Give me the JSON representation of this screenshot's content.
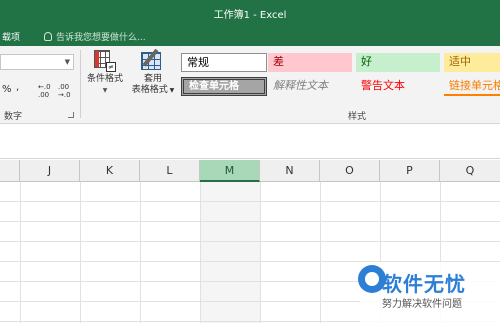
{
  "window": {
    "title": "工作簿1 - Excel"
  },
  "tabs": {
    "page_layout": "载项"
  },
  "tell_me": {
    "placeholder": "告诉我您想要做什么..."
  },
  "number_group": {
    "percent": "%",
    "comma": ",",
    "increase_decimal": "←.0 .00",
    "decrease_decimal": ".00 →.0",
    "label": "数字"
  },
  "styles_group": {
    "conditional_format": "条件格式",
    "format_as_table_line1": "套用",
    "format_as_table_line2": "表格格式",
    "cells": {
      "normal": "常规",
      "bad": "差",
      "good": "好",
      "neutral": "适中",
      "check": "检查单元格",
      "explanatory": "解释性文本",
      "warning": "警告文本",
      "link": "链接单元格"
    },
    "label": "样式"
  },
  "columns": [
    "J",
    "K",
    "L",
    "M",
    "N",
    "O",
    "P",
    "Q"
  ],
  "selected_column": "M",
  "watermark": {
    "title": "软件无忧",
    "subtitle": "努力解决软件问题"
  }
}
